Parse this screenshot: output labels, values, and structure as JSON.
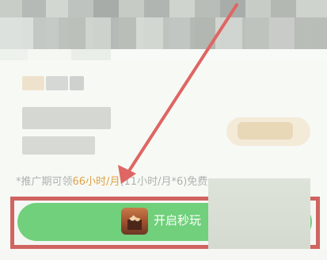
{
  "promo": {
    "prefix": "*推广期可领",
    "highlight": "66小时/月",
    "suffix": "(11小时/月*6)免费"
  },
  "button": {
    "label": "开启秒玩"
  },
  "icons": {
    "game": "game-icon",
    "arrow": "arrow-icon"
  },
  "colors": {
    "button_green": "#70d07b",
    "highlight_orange": "#e0a346",
    "annotation_red": "#cf6461"
  }
}
